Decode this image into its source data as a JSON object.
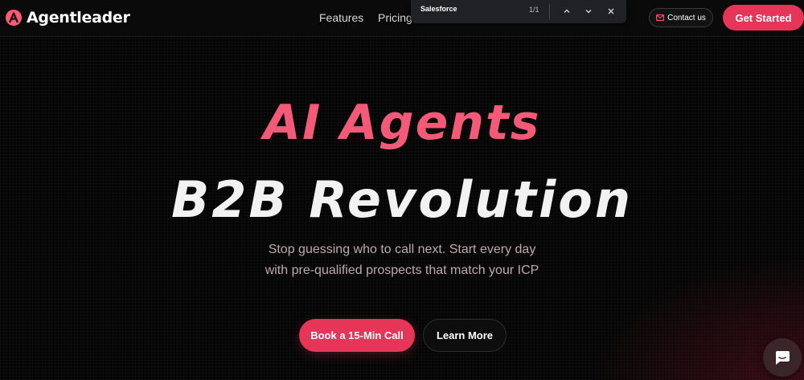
{
  "brand": {
    "name": "Agentleader",
    "logo_icon": "a-letter-logo-icon",
    "logo_color": "#ff5a72"
  },
  "nav": {
    "links": [
      {
        "label": "Features"
      },
      {
        "label": "Pricing"
      }
    ],
    "contact": {
      "label": "Contact us",
      "icon": "mail-icon"
    },
    "get_started": {
      "label": "Get Started"
    }
  },
  "find_bar": {
    "query": "Salesforce",
    "count": "1/1",
    "icons": [
      "chevron-up-icon",
      "chevron-down-icon",
      "close-icon"
    ]
  },
  "hero": {
    "line1": "AI Agents",
    "line2": "B2B Revolution",
    "subtitle_line1": "Stop guessing who to call next. Start every day",
    "subtitle_line2": "with pre-qualified prospects that match your ICP"
  },
  "cta": {
    "primary": "Book a 15-Min Call",
    "secondary": "Learn More"
  },
  "chat": {
    "icon": "chat-bubble-icon"
  },
  "colors": {
    "accent": "#e53559",
    "headline_pink": "#f25a78",
    "background": "#050505"
  }
}
